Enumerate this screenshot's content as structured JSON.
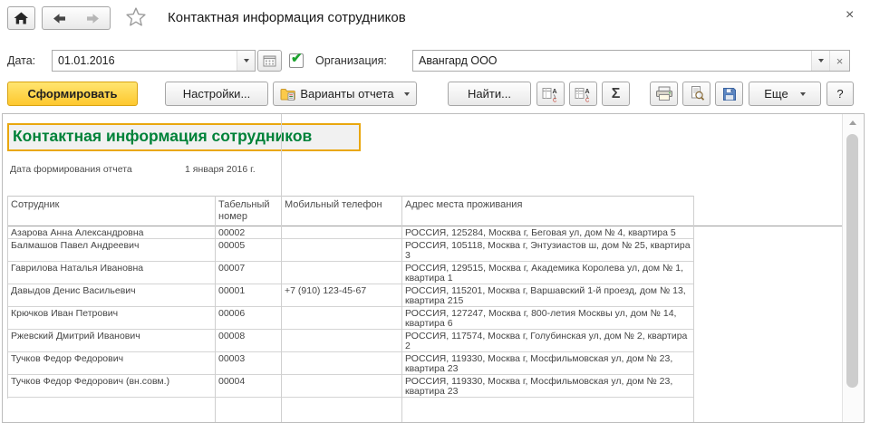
{
  "window": {
    "title": "Контактная информация сотрудников"
  },
  "filters": {
    "date_label": "Дата:",
    "date_value": "01.01.2016",
    "org_label": "Организация:",
    "org_value": "Авангард ООО"
  },
  "toolbar": {
    "generate": "Сформировать",
    "settings": "Настройки...",
    "report_variants": "Варианты отчета",
    "find": "Найти...",
    "sum_sigma": "Σ",
    "more": "Еще",
    "help": "?"
  },
  "report": {
    "title": "Контактная информация сотрудников",
    "generated_label": "Дата формирования отчета",
    "generated_value": "1 января 2016 г.",
    "columns": [
      "Сотрудник",
      "Табельный номер",
      "Мобильный телефон",
      "Адрес места проживания"
    ],
    "rows": [
      {
        "name": "Азарова Анна Александровна",
        "number": "00002",
        "phone": "",
        "address": "РОССИЯ, 125284, Москва г, Беговая ул, дом № 4, квартира 5"
      },
      {
        "name": "Балмашов Павел Андреевич",
        "number": "00005",
        "phone": "",
        "address": "РОССИЯ, 105118, Москва г, Энтузиастов ш, дом № 25, квартира 3"
      },
      {
        "name": "Гаврилова Наталья Ивановна",
        "number": "00007",
        "phone": "",
        "address": "РОССИЯ, 129515, Москва г, Академика Королева ул, дом № 1, квартира 1"
      },
      {
        "name": "Давыдов Денис Васильевич",
        "number": "00001",
        "phone": "+7 (910) 123-45-67",
        "address": "РОССИЯ, 115201, Москва г, Варшавский 1-й проезд, дом № 13, квартира 215"
      },
      {
        "name": "Крючков Иван Петрович",
        "number": "00006",
        "phone": "",
        "address": "РОССИЯ, 127247, Москва г, 800-летия Москвы ул, дом № 14, квартира 6"
      },
      {
        "name": "Ржевский Дмитрий Иванович",
        "number": "00008",
        "phone": "",
        "address": "РОССИЯ, 117574, Москва г, Голубинская ул, дом № 2, квартира 2"
      },
      {
        "name": "Тучков Федор Федорович",
        "number": "00003",
        "phone": "",
        "address": "РОССИЯ, 119330, Москва г, Мосфильмовская ул, дом № 23, квартира 23"
      },
      {
        "name": "Тучков Федор Федорович (вн.совм.)",
        "number": "00004",
        "phone": "",
        "address": "РОССИЯ, 119330, Москва г, Мосфильмовская ул, дом № 23, квартира 23"
      }
    ]
  },
  "colors": {
    "accent_green": "#008239",
    "selection_border": "#e9a70e",
    "generate_button_yellow": "#fec82e"
  },
  "glyphs": {
    "dropdown": "▾",
    "star": "☆",
    "check": "✔",
    "clear": "×",
    "close": "×",
    "scroll_up": "▲"
  }
}
